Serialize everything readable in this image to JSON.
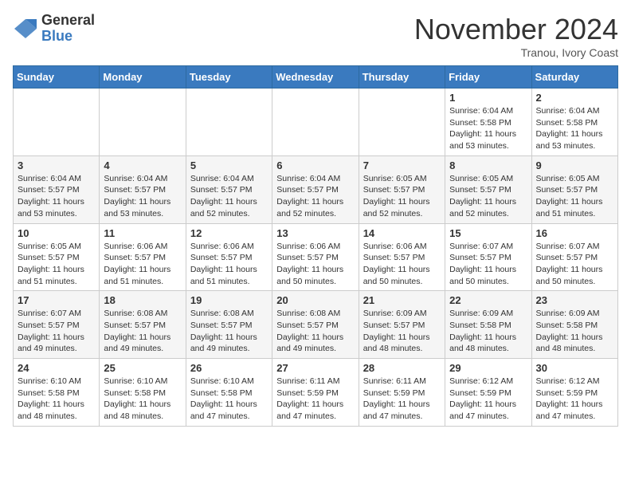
{
  "header": {
    "logo_general": "General",
    "logo_blue": "Blue",
    "month_title": "November 2024",
    "location": "Tranou, Ivory Coast"
  },
  "weekdays": [
    "Sunday",
    "Monday",
    "Tuesday",
    "Wednesday",
    "Thursday",
    "Friday",
    "Saturday"
  ],
  "weeks": [
    [
      {
        "day": "",
        "info": ""
      },
      {
        "day": "",
        "info": ""
      },
      {
        "day": "",
        "info": ""
      },
      {
        "day": "",
        "info": ""
      },
      {
        "day": "",
        "info": ""
      },
      {
        "day": "1",
        "info": "Sunrise: 6:04 AM\nSunset: 5:58 PM\nDaylight: 11 hours\nand 53 minutes."
      },
      {
        "day": "2",
        "info": "Sunrise: 6:04 AM\nSunset: 5:58 PM\nDaylight: 11 hours\nand 53 minutes."
      }
    ],
    [
      {
        "day": "3",
        "info": "Sunrise: 6:04 AM\nSunset: 5:57 PM\nDaylight: 11 hours\nand 53 minutes."
      },
      {
        "day": "4",
        "info": "Sunrise: 6:04 AM\nSunset: 5:57 PM\nDaylight: 11 hours\nand 53 minutes."
      },
      {
        "day": "5",
        "info": "Sunrise: 6:04 AM\nSunset: 5:57 PM\nDaylight: 11 hours\nand 52 minutes."
      },
      {
        "day": "6",
        "info": "Sunrise: 6:04 AM\nSunset: 5:57 PM\nDaylight: 11 hours\nand 52 minutes."
      },
      {
        "day": "7",
        "info": "Sunrise: 6:05 AM\nSunset: 5:57 PM\nDaylight: 11 hours\nand 52 minutes."
      },
      {
        "day": "8",
        "info": "Sunrise: 6:05 AM\nSunset: 5:57 PM\nDaylight: 11 hours\nand 52 minutes."
      },
      {
        "day": "9",
        "info": "Sunrise: 6:05 AM\nSunset: 5:57 PM\nDaylight: 11 hours\nand 51 minutes."
      }
    ],
    [
      {
        "day": "10",
        "info": "Sunrise: 6:05 AM\nSunset: 5:57 PM\nDaylight: 11 hours\nand 51 minutes."
      },
      {
        "day": "11",
        "info": "Sunrise: 6:06 AM\nSunset: 5:57 PM\nDaylight: 11 hours\nand 51 minutes."
      },
      {
        "day": "12",
        "info": "Sunrise: 6:06 AM\nSunset: 5:57 PM\nDaylight: 11 hours\nand 51 minutes."
      },
      {
        "day": "13",
        "info": "Sunrise: 6:06 AM\nSunset: 5:57 PM\nDaylight: 11 hours\nand 50 minutes."
      },
      {
        "day": "14",
        "info": "Sunrise: 6:06 AM\nSunset: 5:57 PM\nDaylight: 11 hours\nand 50 minutes."
      },
      {
        "day": "15",
        "info": "Sunrise: 6:07 AM\nSunset: 5:57 PM\nDaylight: 11 hours\nand 50 minutes."
      },
      {
        "day": "16",
        "info": "Sunrise: 6:07 AM\nSunset: 5:57 PM\nDaylight: 11 hours\nand 50 minutes."
      }
    ],
    [
      {
        "day": "17",
        "info": "Sunrise: 6:07 AM\nSunset: 5:57 PM\nDaylight: 11 hours\nand 49 minutes."
      },
      {
        "day": "18",
        "info": "Sunrise: 6:08 AM\nSunset: 5:57 PM\nDaylight: 11 hours\nand 49 minutes."
      },
      {
        "day": "19",
        "info": "Sunrise: 6:08 AM\nSunset: 5:57 PM\nDaylight: 11 hours\nand 49 minutes."
      },
      {
        "day": "20",
        "info": "Sunrise: 6:08 AM\nSunset: 5:57 PM\nDaylight: 11 hours\nand 49 minutes."
      },
      {
        "day": "21",
        "info": "Sunrise: 6:09 AM\nSunset: 5:57 PM\nDaylight: 11 hours\nand 48 minutes."
      },
      {
        "day": "22",
        "info": "Sunrise: 6:09 AM\nSunset: 5:58 PM\nDaylight: 11 hours\nand 48 minutes."
      },
      {
        "day": "23",
        "info": "Sunrise: 6:09 AM\nSunset: 5:58 PM\nDaylight: 11 hours\nand 48 minutes."
      }
    ],
    [
      {
        "day": "24",
        "info": "Sunrise: 6:10 AM\nSunset: 5:58 PM\nDaylight: 11 hours\nand 48 minutes."
      },
      {
        "day": "25",
        "info": "Sunrise: 6:10 AM\nSunset: 5:58 PM\nDaylight: 11 hours\nand 48 minutes."
      },
      {
        "day": "26",
        "info": "Sunrise: 6:10 AM\nSunset: 5:58 PM\nDaylight: 11 hours\nand 47 minutes."
      },
      {
        "day": "27",
        "info": "Sunrise: 6:11 AM\nSunset: 5:59 PM\nDaylight: 11 hours\nand 47 minutes."
      },
      {
        "day": "28",
        "info": "Sunrise: 6:11 AM\nSunset: 5:59 PM\nDaylight: 11 hours\nand 47 minutes."
      },
      {
        "day": "29",
        "info": "Sunrise: 6:12 AM\nSunset: 5:59 PM\nDaylight: 11 hours\nand 47 minutes."
      },
      {
        "day": "30",
        "info": "Sunrise: 6:12 AM\nSunset: 5:59 PM\nDaylight: 11 hours\nand 47 minutes."
      }
    ]
  ]
}
